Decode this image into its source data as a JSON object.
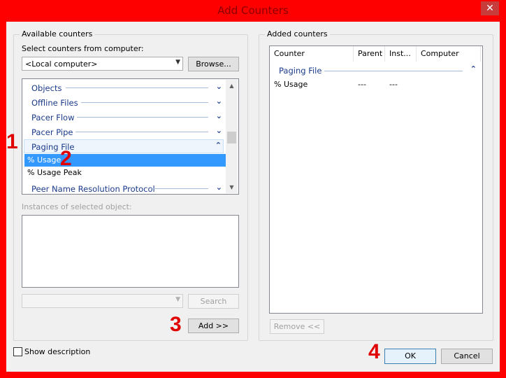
{
  "window": {
    "title": "Add Counters",
    "close_glyph": "✕"
  },
  "available": {
    "group_title": "Available counters",
    "select_label": "Select counters from computer:",
    "computer_value": "<Local computer>",
    "browse_label": "Browse...",
    "objects": [
      {
        "name": "Objects",
        "state": "collapsed"
      },
      {
        "name": "Offline Files",
        "state": "collapsed"
      },
      {
        "name": "Pacer Flow",
        "state": "collapsed"
      },
      {
        "name": "Pacer Pipe",
        "state": "collapsed"
      },
      {
        "name": "Paging File",
        "state": "expanded"
      },
      {
        "name": "Peer Name Resolution Protocol",
        "state": "collapsed"
      }
    ],
    "counters": [
      {
        "name": "% Usage",
        "selected": true
      },
      {
        "name": "% Usage Peak",
        "selected": false
      }
    ],
    "instances_label": "Instances of selected object:",
    "search_label": "Search",
    "add_label": "Add >>"
  },
  "added": {
    "group_title": "Added counters",
    "columns": [
      "Counter",
      "Parent",
      "Inst...",
      "Computer"
    ],
    "group_name": "Paging File",
    "rows": [
      {
        "counter": "% Usage",
        "parent": "---",
        "instance": "---",
        "computer": ""
      }
    ],
    "remove_label": "Remove <<"
  },
  "show_description_label": "Show description",
  "ok_label": "OK",
  "cancel_label": "Cancel",
  "annotations": [
    "1",
    "2",
    "3",
    "4"
  ],
  "colors": {
    "frame": "#ff0000",
    "annotation": "#e00000",
    "selection": "#3399ff",
    "object_text": "#1a3a8a"
  }
}
